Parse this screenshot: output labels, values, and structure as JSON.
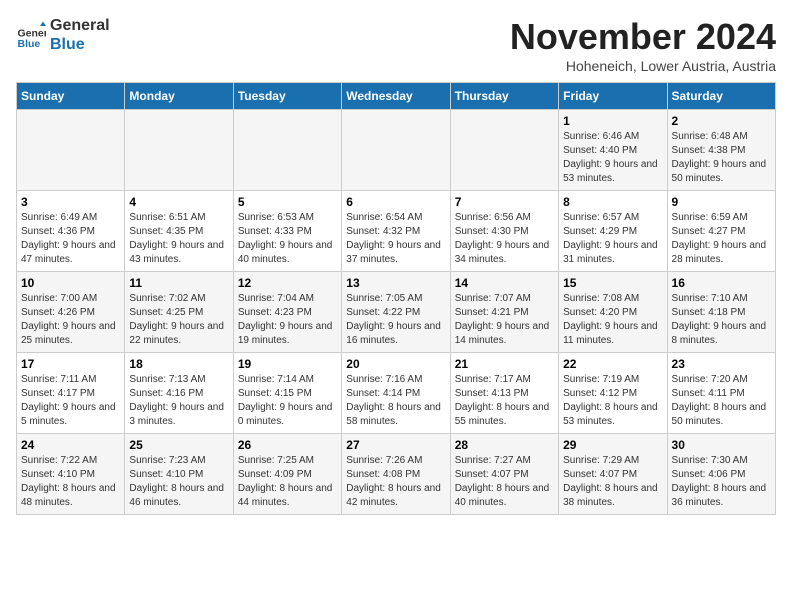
{
  "logo": {
    "line1": "General",
    "line2": "Blue"
  },
  "title": "November 2024",
  "subtitle": "Hoheneich, Lower Austria, Austria",
  "days_of_week": [
    "Sunday",
    "Monday",
    "Tuesday",
    "Wednesday",
    "Thursday",
    "Friday",
    "Saturday"
  ],
  "weeks": [
    [
      {
        "day": "",
        "info": ""
      },
      {
        "day": "",
        "info": ""
      },
      {
        "day": "",
        "info": ""
      },
      {
        "day": "",
        "info": ""
      },
      {
        "day": "",
        "info": ""
      },
      {
        "day": "1",
        "info": "Sunrise: 6:46 AM\nSunset: 4:40 PM\nDaylight: 9 hours and 53 minutes."
      },
      {
        "day": "2",
        "info": "Sunrise: 6:48 AM\nSunset: 4:38 PM\nDaylight: 9 hours and 50 minutes."
      }
    ],
    [
      {
        "day": "3",
        "info": "Sunrise: 6:49 AM\nSunset: 4:36 PM\nDaylight: 9 hours and 47 minutes."
      },
      {
        "day": "4",
        "info": "Sunrise: 6:51 AM\nSunset: 4:35 PM\nDaylight: 9 hours and 43 minutes."
      },
      {
        "day": "5",
        "info": "Sunrise: 6:53 AM\nSunset: 4:33 PM\nDaylight: 9 hours and 40 minutes."
      },
      {
        "day": "6",
        "info": "Sunrise: 6:54 AM\nSunset: 4:32 PM\nDaylight: 9 hours and 37 minutes."
      },
      {
        "day": "7",
        "info": "Sunrise: 6:56 AM\nSunset: 4:30 PM\nDaylight: 9 hours and 34 minutes."
      },
      {
        "day": "8",
        "info": "Sunrise: 6:57 AM\nSunset: 4:29 PM\nDaylight: 9 hours and 31 minutes."
      },
      {
        "day": "9",
        "info": "Sunrise: 6:59 AM\nSunset: 4:27 PM\nDaylight: 9 hours and 28 minutes."
      }
    ],
    [
      {
        "day": "10",
        "info": "Sunrise: 7:00 AM\nSunset: 4:26 PM\nDaylight: 9 hours and 25 minutes."
      },
      {
        "day": "11",
        "info": "Sunrise: 7:02 AM\nSunset: 4:25 PM\nDaylight: 9 hours and 22 minutes."
      },
      {
        "day": "12",
        "info": "Sunrise: 7:04 AM\nSunset: 4:23 PM\nDaylight: 9 hours and 19 minutes."
      },
      {
        "day": "13",
        "info": "Sunrise: 7:05 AM\nSunset: 4:22 PM\nDaylight: 9 hours and 16 minutes."
      },
      {
        "day": "14",
        "info": "Sunrise: 7:07 AM\nSunset: 4:21 PM\nDaylight: 9 hours and 14 minutes."
      },
      {
        "day": "15",
        "info": "Sunrise: 7:08 AM\nSunset: 4:20 PM\nDaylight: 9 hours and 11 minutes."
      },
      {
        "day": "16",
        "info": "Sunrise: 7:10 AM\nSunset: 4:18 PM\nDaylight: 9 hours and 8 minutes."
      }
    ],
    [
      {
        "day": "17",
        "info": "Sunrise: 7:11 AM\nSunset: 4:17 PM\nDaylight: 9 hours and 5 minutes."
      },
      {
        "day": "18",
        "info": "Sunrise: 7:13 AM\nSunset: 4:16 PM\nDaylight: 9 hours and 3 minutes."
      },
      {
        "day": "19",
        "info": "Sunrise: 7:14 AM\nSunset: 4:15 PM\nDaylight: 9 hours and 0 minutes."
      },
      {
        "day": "20",
        "info": "Sunrise: 7:16 AM\nSunset: 4:14 PM\nDaylight: 8 hours and 58 minutes."
      },
      {
        "day": "21",
        "info": "Sunrise: 7:17 AM\nSunset: 4:13 PM\nDaylight: 8 hours and 55 minutes."
      },
      {
        "day": "22",
        "info": "Sunrise: 7:19 AM\nSunset: 4:12 PM\nDaylight: 8 hours and 53 minutes."
      },
      {
        "day": "23",
        "info": "Sunrise: 7:20 AM\nSunset: 4:11 PM\nDaylight: 8 hours and 50 minutes."
      }
    ],
    [
      {
        "day": "24",
        "info": "Sunrise: 7:22 AM\nSunset: 4:10 PM\nDaylight: 8 hours and 48 minutes."
      },
      {
        "day": "25",
        "info": "Sunrise: 7:23 AM\nSunset: 4:10 PM\nDaylight: 8 hours and 46 minutes."
      },
      {
        "day": "26",
        "info": "Sunrise: 7:25 AM\nSunset: 4:09 PM\nDaylight: 8 hours and 44 minutes."
      },
      {
        "day": "27",
        "info": "Sunrise: 7:26 AM\nSunset: 4:08 PM\nDaylight: 8 hours and 42 minutes."
      },
      {
        "day": "28",
        "info": "Sunrise: 7:27 AM\nSunset: 4:07 PM\nDaylight: 8 hours and 40 minutes."
      },
      {
        "day": "29",
        "info": "Sunrise: 7:29 AM\nSunset: 4:07 PM\nDaylight: 8 hours and 38 minutes."
      },
      {
        "day": "30",
        "info": "Sunrise: 7:30 AM\nSunset: 4:06 PM\nDaylight: 8 hours and 36 minutes."
      }
    ]
  ]
}
